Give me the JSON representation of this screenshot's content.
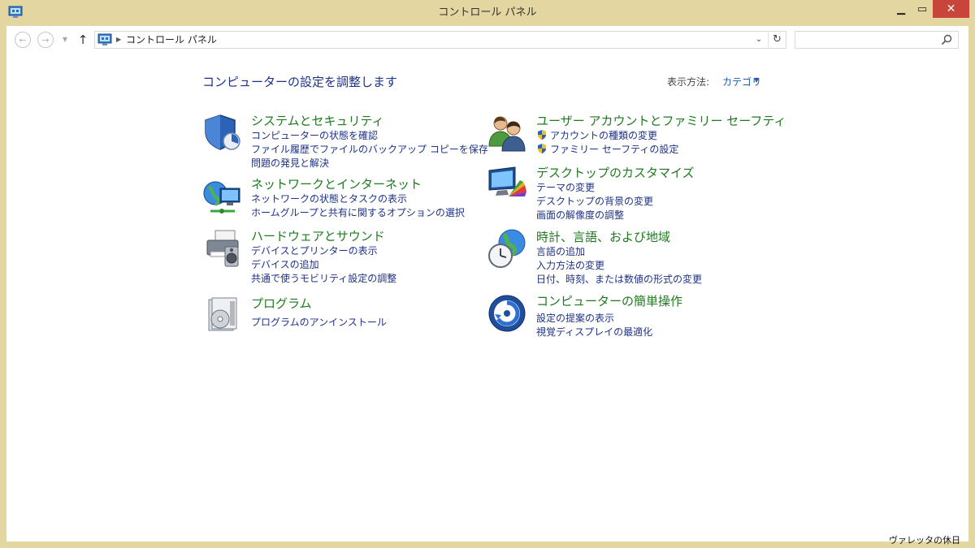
{
  "window": {
    "title": "コントロール パネル"
  },
  "navbar": {
    "breadcrumb": "コントロール パネル",
    "search_placeholder": ""
  },
  "header": {
    "heading": "コンピューターの設定を調整します",
    "view_label": "表示方法:",
    "view_value": "カテゴリ"
  },
  "categories": [
    {
      "title": "システムとセキュリティ",
      "links": [
        "コンピューターの状態を確認",
        "ファイル履歴でファイルのバックアップ コピーを保存",
        "問題の発見と解決"
      ]
    },
    {
      "title": "ネットワークとインターネット",
      "links": [
        "ネットワークの状態とタスクの表示",
        "ホームグループと共有に関するオプションの選択"
      ]
    },
    {
      "title": "ハードウェアとサウンド",
      "links": [
        "デバイスとプリンターの表示",
        "デバイスの追加",
        "共通で使うモビリティ設定の調整"
      ]
    },
    {
      "title": "プログラム",
      "links": [
        "プログラムのアンインストール"
      ]
    },
    {
      "title": "ユーザー アカウントとファミリー セーフティ",
      "links": [
        "アカウントの種類の変更",
        "ファミリー セーフティの設定"
      ]
    },
    {
      "title": "デスクトップのカスタマイズ",
      "links": [
        "テーマの変更",
        "デスクトップの背景の変更",
        "画面の解像度の調整"
      ]
    },
    {
      "title": "時計、言語、および地域",
      "links": [
        "言語の追加",
        "入力方法の変更",
        "日付、時刻、または数値の形式の変更"
      ]
    },
    {
      "title": "コンピューターの簡単操作",
      "links": [
        "設定の提案の表示",
        "視覚ディスプレイの最適化"
      ]
    }
  ],
  "watermark": "ヴァレッタの休日"
}
